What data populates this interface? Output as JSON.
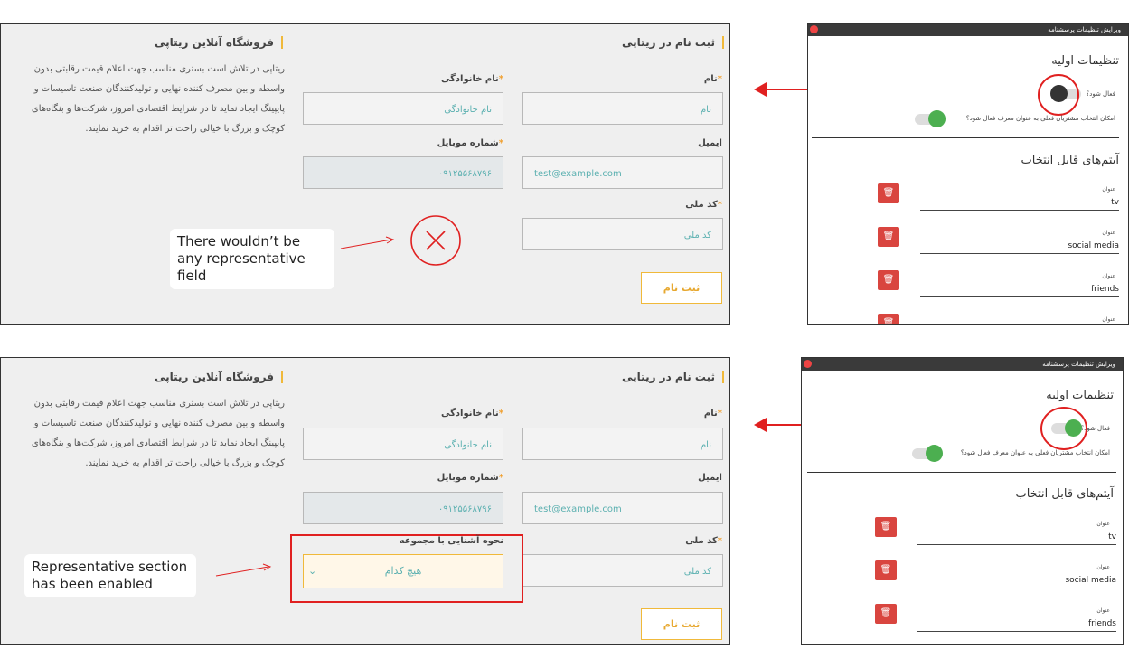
{
  "form": {
    "shop_title": "فروشگاه آنلاین ریتاپی",
    "register_title": "ثبت نام در ریتاپی",
    "description": "ریتاپی در تلاش است بستری مناسب جهت اعلام قیمت رقابتی بدون واسطه و بین مصرف کننده نهایی و تولیدکنندگان صنعت تاسیسات و پایپینگ ایجاد نماید تا در شرایط اقتصادی امروز، شرکت‌ها و بنگاه‌های کوچک و بزرگ با خیالی راحت تر اقدام به خرید نمایند.",
    "first_name_label": "نام",
    "first_name_placeholder": "نام",
    "last_name_label": "نام خانوادگی",
    "last_name_placeholder": "نام خانوادگی",
    "email_label": "ایمیل",
    "email_value": "test@example.com",
    "mobile_label": "شماره موبایل",
    "mobile_value": "۰۹۱۲۵۵۶۸۷۹۶",
    "national_code_label": "کد ملی",
    "national_code_placeholder": "کد ملی",
    "submit_label": "ثبت نام",
    "required_mark": "*",
    "representative_label": "نحوه آشنایی با مجموعه",
    "representative_value": "هیچ کدام",
    "chevron": "⌄"
  },
  "notes": {
    "top": "There wouldn’t be any representative field",
    "bottom": "Representative section has been enabled"
  },
  "panel": {
    "window_title": "ویرایش تنظیمات پرسشنامه",
    "basic_settings": "تنظیمات اولیه",
    "active_label": "فعال شود؟",
    "representative_toggle_label": "امکان انتخاب مشتریان فعلی به عنوان معرف فعال شود؟",
    "items_title": "آیتم‌های قابل انتخاب",
    "item_field_label": "عنوان",
    "items": [
      "tv",
      "social media",
      "friends"
    ],
    "trash_icon": "🗑"
  },
  "colors": {
    "accent": "#f0b93a",
    "toggle_on": "#4caf50",
    "toggle_off": "#333333",
    "annotation_red": "#e02020",
    "delete_red": "#d9453f"
  }
}
